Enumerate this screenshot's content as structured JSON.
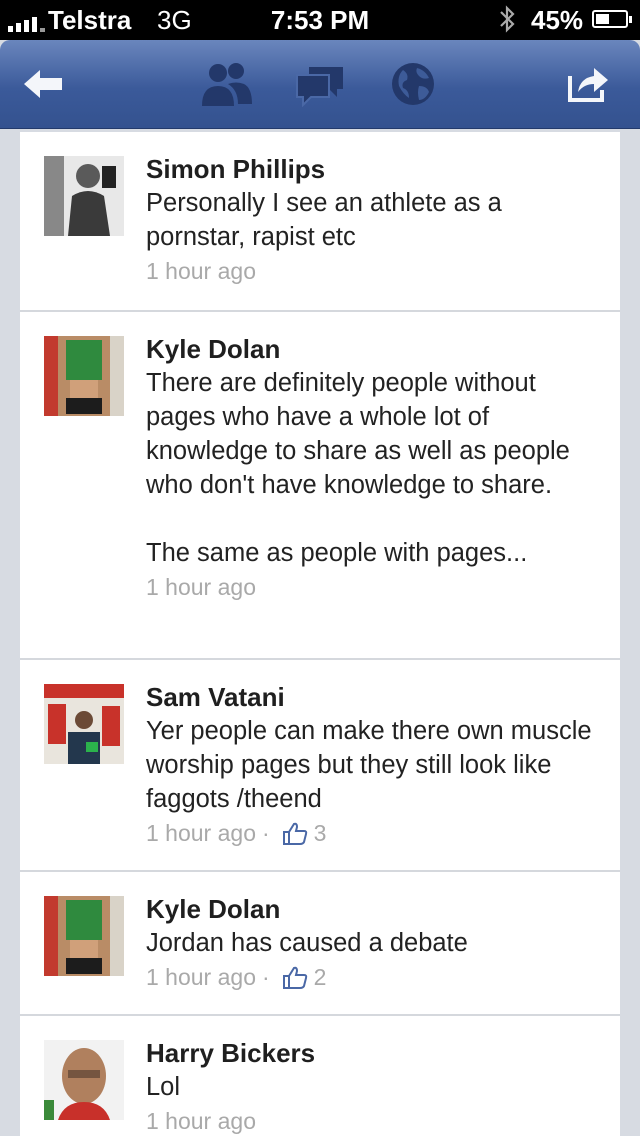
{
  "status_bar": {
    "carrier": "Telstra",
    "network": "3G",
    "time": "7:53 PM",
    "battery_percent": "45%",
    "battery_level": 0.45,
    "bluetooth_icon": "bluetooth-icon"
  },
  "nav": {
    "icons": [
      "back-arrow-icon",
      "friends-icon",
      "messages-icon",
      "globe-icon",
      "share-icon"
    ],
    "brand_color": "#3b5a9a"
  },
  "comments": [
    {
      "author": "Simon Phillips",
      "text": "Personally I see an athlete as a pornstar, rapist etc",
      "time": "1 hour ago",
      "likes": ""
    },
    {
      "author": "Kyle Dolan",
      "text": "There are definitely people without pages who have a whole lot of knowledge to share as well as people who don't have knowledge to share.\n\nThe same as people with pages...",
      "time": "1 hour ago",
      "likes": ""
    },
    {
      "author": "Sam Vatani",
      "text": "Yer people can make there own muscle worship pages but they still look like faggots /theend",
      "time": "1 hour ago",
      "likes": "3"
    },
    {
      "author": "Kyle Dolan",
      "text": "Jordan has caused a debate",
      "time": "1 hour ago",
      "likes": "2"
    },
    {
      "author": "Harry Bickers",
      "text": "Lol",
      "time": "1 hour ago",
      "likes": ""
    }
  ]
}
